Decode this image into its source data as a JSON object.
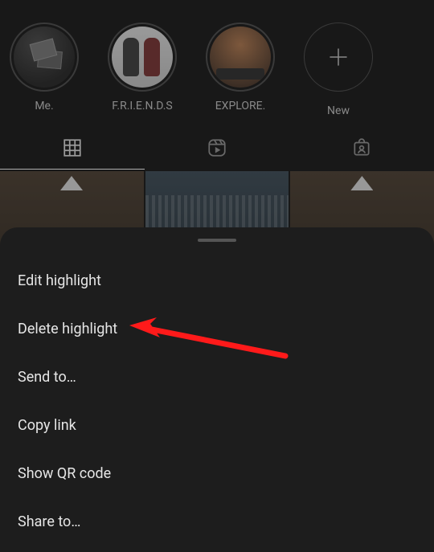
{
  "highlights": {
    "items": [
      {
        "label": "Me."
      },
      {
        "label": "F.R.I.E.N.D.S"
      },
      {
        "label": "EXPLORE."
      }
    ],
    "new_label": "New"
  },
  "tabs": {
    "grid_name": "grid-tab",
    "reels_name": "reels-tab",
    "tagged_name": "tagged-tab"
  },
  "menu": {
    "edit": "Edit highlight",
    "delete": "Delete highlight",
    "send": "Send to…",
    "copy": "Copy link",
    "qr": "Show QR code",
    "share": "Share to…"
  }
}
